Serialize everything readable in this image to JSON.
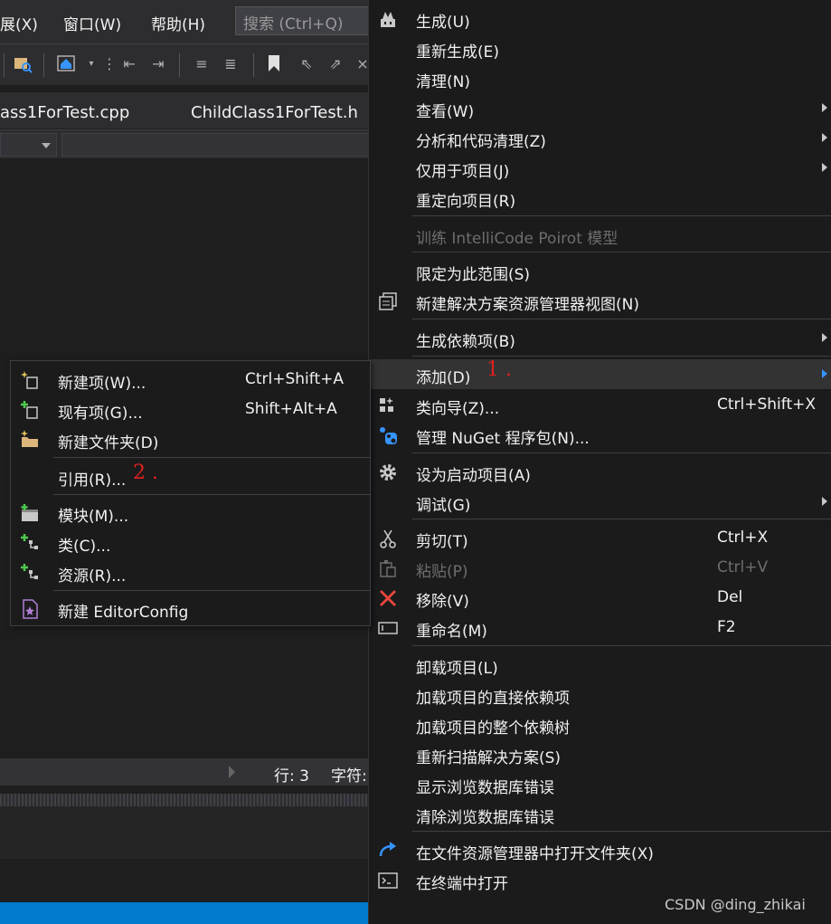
{
  "menubar": {
    "items": [
      "展(X)",
      "窗口(W)",
      "帮助(H)"
    ],
    "search_placeholder": "搜索 (Ctrl+Q)"
  },
  "tabs": [
    "ass1ForTest.cpp",
    "ChildClass1ForTest.h"
  ],
  "status": {
    "line": "行: 3",
    "char": "字符:"
  },
  "context_menu": {
    "items": [
      {
        "label": "生成(U)",
        "icon": "build-icon"
      },
      {
        "label": "重新生成(E)"
      },
      {
        "label": "清理(N)"
      },
      {
        "label": "查看(W)",
        "submenu": true
      },
      {
        "label": "分析和代码清理(Z)",
        "submenu": true
      },
      {
        "label": "仅用于项目(J)",
        "submenu": true
      },
      {
        "label": "重定向项目(R)"
      },
      {
        "label": "训练 IntelliCode Poirot 模型",
        "disabled": true
      },
      {
        "label": "限定为此范围(S)"
      },
      {
        "label": "新建解决方案资源管理器视图(N)",
        "icon": "new-view-icon"
      },
      {
        "label": "生成依赖项(B)",
        "submenu": true
      },
      {
        "label": "添加(D)",
        "submenu": true,
        "highlighted": true
      },
      {
        "label": "类向导(Z)...",
        "shortcut": "Ctrl+Shift+X",
        "icon": "class-wizard-icon"
      },
      {
        "label": "管理 NuGet 程序包(N)...",
        "icon": "nuget-icon"
      },
      {
        "label": "设为启动项目(A)",
        "icon": "gear-icon"
      },
      {
        "label": "调试(G)",
        "submenu": true
      },
      {
        "label": "剪切(T)",
        "shortcut": "Ctrl+X",
        "icon": "scissors-icon"
      },
      {
        "label": "粘贴(P)",
        "shortcut": "Ctrl+V",
        "icon": "paste-icon",
        "disabled": true
      },
      {
        "label": "移除(V)",
        "shortcut": "Del",
        "icon": "remove-icon"
      },
      {
        "label": "重命名(M)",
        "shortcut": "F2",
        "icon": "rename-icon"
      },
      {
        "label": "卸载项目(L)"
      },
      {
        "label": "加载项目的直接依赖项"
      },
      {
        "label": "加载项目的整个依赖树"
      },
      {
        "label": "重新扫描解决方案(S)"
      },
      {
        "label": "显示浏览数据库错误"
      },
      {
        "label": "清除浏览数据库错误"
      },
      {
        "label": "在文件资源管理器中打开文件夹(X)",
        "icon": "open-folder-icon"
      },
      {
        "label": "在终端中打开",
        "icon": "terminal-icon"
      }
    ]
  },
  "add_submenu": {
    "items": [
      {
        "label": "新建项(W)...",
        "shortcut": "Ctrl+Shift+A",
        "icon": "new-item-icon"
      },
      {
        "label": "现有项(G)...",
        "shortcut": "Shift+Alt+A",
        "icon": "existing-item-icon"
      },
      {
        "label": "新建文件夹(D)",
        "icon": "new-folder-icon"
      },
      {
        "label": "引用(R)..."
      },
      {
        "label": "模块(M)...",
        "icon": "module-icon"
      },
      {
        "label": "类(C)...",
        "icon": "class-icon"
      },
      {
        "label": "资源(R)...",
        "icon": "resource-icon"
      },
      {
        "label": "新建 EditorConfig",
        "icon": "editorconfig-icon"
      }
    ]
  },
  "annotations": {
    "first": "1 .",
    "second": "2 ."
  },
  "colors": {
    "accent": "#007acc",
    "annotation": "#e0201f",
    "remove": "#e8473c"
  },
  "watermark": "CSDN @ding_zhikai"
}
